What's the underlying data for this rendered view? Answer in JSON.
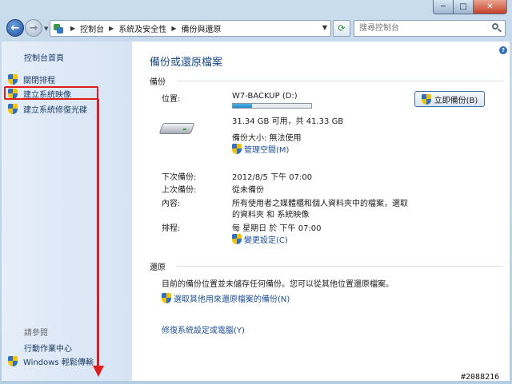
{
  "window": {
    "min_glyph": "─",
    "max_glyph": "□",
    "close_glyph": "✕"
  },
  "nav": {
    "back_glyph": "←",
    "forward_glyph": "→",
    "history_glyph": "▼",
    "breadcrumb": [
      "控制台",
      "系統及安全性",
      "備份與還原"
    ],
    "breadcrumb_sep": "▶",
    "address_dropdown": "▼",
    "refresh_glyph": "⟳",
    "search_placeholder": "搜尋控制台"
  },
  "sidebar": {
    "home": "控制台首頁",
    "items": [
      "關閉排程",
      "建立系統映像",
      "建立系統修復光碟"
    ],
    "see_also": "請參閱",
    "links": [
      "行動作業中心",
      "Windows 輕鬆傳輸"
    ]
  },
  "content": {
    "help": "?",
    "title": "備份或還原檔案",
    "backup_section": "備份",
    "location_label": "位置:",
    "location_value": "W7-BACKUP (D:)",
    "disk_usage": 0.24,
    "free_space": "31.34 GB 可用，共 41.33 GB",
    "backup_size": "備份大小: 無法使用",
    "manage_space": "管理空間(M)",
    "backup_now": "立即備份(B)",
    "next_label": "下次備份:",
    "next_value": "2012/8/5 下午 07:00",
    "last_label": "上次備份:",
    "last_value": "從未備份",
    "contents_label": "內容:",
    "contents_value_1": "所有使用者之媒體櫃和個人資料夾中的檔案，選取",
    "contents_value_2": "的資料夾 和 系統映像",
    "schedule_label": "排程:",
    "schedule_value": "每 星期日 於 下午 07:00",
    "change_settings": "變更設定(C)",
    "restore_section": "還原",
    "restore_desc": "目前的備份位置並未儲存任何備份。您可以從其他位置還原檔案。",
    "select_backup": "選取其他用來還原檔案的備份(N)",
    "recover_link": "修復系統設定或電腦(Y)"
  },
  "watermark": "#2088216"
}
